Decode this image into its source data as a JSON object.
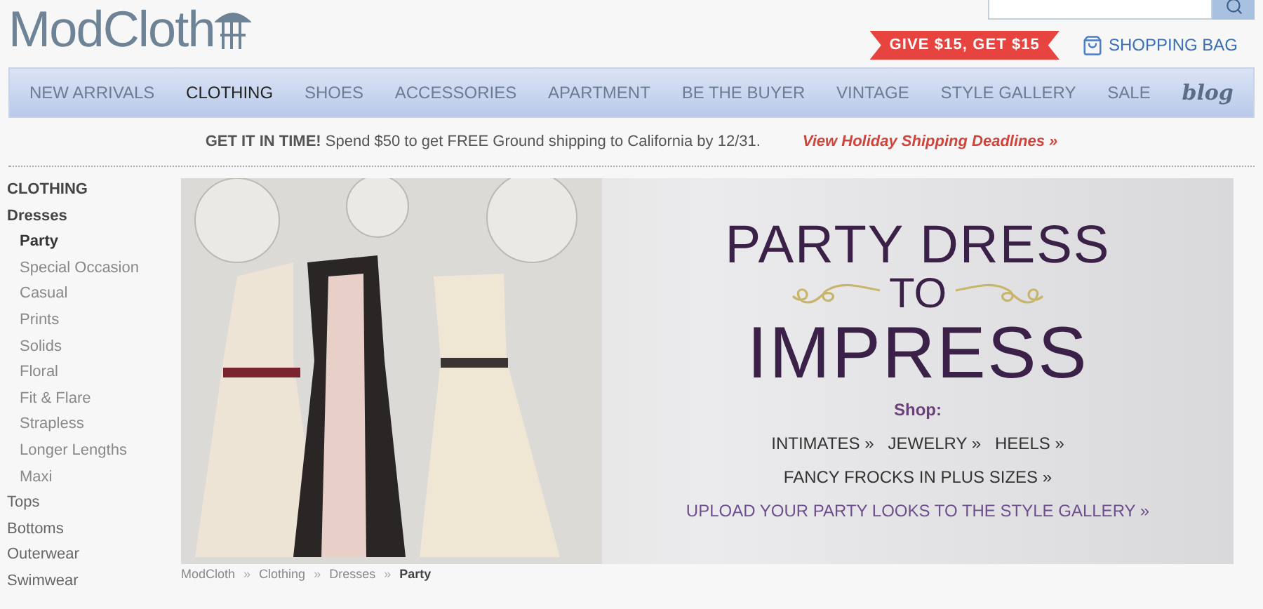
{
  "logo": {
    "text": "ModCloth"
  },
  "promo_tag": "GIVE $15, GET $15",
  "shopping_bag": "SHOPPING BAG",
  "nav": [
    {
      "label": "NEW ARRIVALS",
      "selected": false
    },
    {
      "label": "CLOTHING",
      "selected": true
    },
    {
      "label": "SHOES",
      "selected": false
    },
    {
      "label": "ACCESSORIES",
      "selected": false
    },
    {
      "label": "APARTMENT",
      "selected": false
    },
    {
      "label": "BE THE BUYER",
      "selected": false
    },
    {
      "label": "VINTAGE",
      "selected": false
    },
    {
      "label": "STYLE GALLERY",
      "selected": false
    },
    {
      "label": "SALE",
      "selected": false
    },
    {
      "label": "blog",
      "selected": false,
      "kind": "script"
    }
  ],
  "shipping_bar": {
    "lead": "GET IT IN TIME!",
    "text": "Spend $50 to get FREE Ground shipping to California by 12/31.",
    "link": "View Holiday Shipping Deadlines »"
  },
  "sidebar": {
    "heading": "CLOTHING",
    "items": [
      {
        "label": "Dresses",
        "selected": false,
        "children": [
          {
            "label": "Party",
            "selected": true
          },
          {
            "label": "Special Occasion",
            "selected": false
          },
          {
            "label": "Casual",
            "selected": false
          },
          {
            "label": "Prints",
            "selected": false
          },
          {
            "label": "Solids",
            "selected": false
          },
          {
            "label": "Floral",
            "selected": false
          },
          {
            "label": "Fit & Flare",
            "selected": false
          },
          {
            "label": "Strapless",
            "selected": false
          },
          {
            "label": "Longer Lengths",
            "selected": false
          },
          {
            "label": "Maxi",
            "selected": false
          }
        ]
      },
      {
        "label": "Tops",
        "selected": false
      },
      {
        "label": "Bottoms",
        "selected": false
      },
      {
        "label": "Outerwear",
        "selected": false
      },
      {
        "label": "Swimwear",
        "selected": false
      }
    ]
  },
  "banner": {
    "title_top": "PARTY DRESS",
    "title_middle": "TO",
    "title_bottom": "IMPRESS",
    "shop_label": "Shop:",
    "links": [
      [
        "INTIMATES »",
        "JEWELRY »",
        "HEELS »"
      ],
      [
        "FANCY FROCKS IN PLUS SIZES »"
      ]
    ],
    "gallery_link": "UPLOAD YOUR PARTY LOOKS TO THE STYLE GALLERY »"
  },
  "breadcrumb_separator": "»",
  "breadcrumb": [
    {
      "label": "ModCloth",
      "current": false
    },
    {
      "label": "Clothing",
      "current": false
    },
    {
      "label": "Dresses",
      "current": false
    },
    {
      "label": "Party",
      "current": true
    }
  ]
}
